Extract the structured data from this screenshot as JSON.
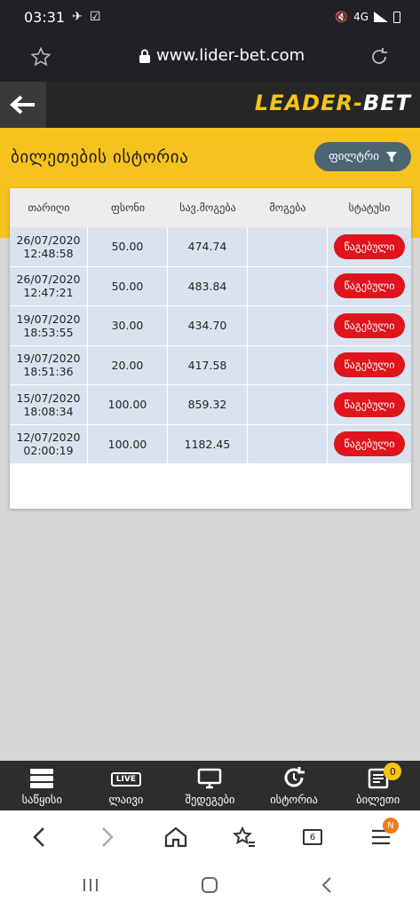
{
  "status_bar": {
    "time": "03:31",
    "network": "4G"
  },
  "browser": {
    "url": "www.lider-bet.com",
    "tab_count": "6",
    "menu_badge": "N"
  },
  "site": {
    "logo_part1": "LEADER",
    "logo_sep": "-",
    "logo_part2": "BET"
  },
  "page": {
    "title": "ბილეთების ისტორია",
    "filter_label": "ფილტრი"
  },
  "table": {
    "headers": [
      "თარიღი",
      "ფსონი",
      "სავ.მოგება",
      "მოგება",
      "სტატუსი"
    ],
    "rows": [
      {
        "date": "26/07/2020",
        "time": "12:48:58",
        "stake": "50.00",
        "potential": "474.74",
        "win": "",
        "status": "წაგებული"
      },
      {
        "date": "26/07/2020",
        "time": "12:47:21",
        "stake": "50.00",
        "potential": "483.84",
        "win": "",
        "status": "წაგებული"
      },
      {
        "date": "19/07/2020",
        "time": "18:53:55",
        "stake": "30.00",
        "potential": "434.70",
        "win": "",
        "status": "წაგებული"
      },
      {
        "date": "19/07/2020",
        "time": "18:51:36",
        "stake": "20.00",
        "potential": "417.58",
        "win": "",
        "status": "წაგებული"
      },
      {
        "date": "15/07/2020",
        "time": "18:08:34",
        "stake": "100.00",
        "potential": "859.32",
        "win": "",
        "status": "წაგებული"
      },
      {
        "date": "12/07/2020",
        "time": "02:00:19",
        "stake": "100.00",
        "potential": "1182.45",
        "win": "",
        "status": "წაგებული"
      }
    ]
  },
  "site_nav": {
    "items": [
      {
        "label": "საწყისი",
        "icon": "home-stack-icon"
      },
      {
        "label": "ლაივი",
        "icon": "live-icon",
        "icon_text": "LIVE"
      },
      {
        "label": "შედეგები",
        "icon": "monitor-icon"
      },
      {
        "label": "ისტორია",
        "icon": "history-icon"
      },
      {
        "label": "ბილეთი",
        "icon": "ticket-icon",
        "badge": "0"
      }
    ]
  },
  "colors": {
    "accent": "#f6c21d",
    "status_lost": "#e0141c",
    "filter_button": "#4c6573",
    "row_bg": "#d9e3ef"
  }
}
